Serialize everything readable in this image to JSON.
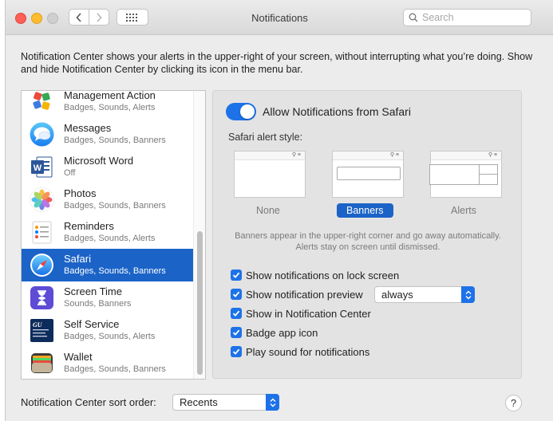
{
  "window": {
    "title": "Notifications",
    "search_placeholder": "Search"
  },
  "description": "Notification Center shows your alerts in the upper-right of your screen, without interrupting what you’re doing. Show and hide Notification Center by clicking its icon in the menu bar.",
  "apps": [
    {
      "name": "Management Action",
      "sub": "Badges, Sounds, Alerts",
      "icon": "management-action-icon",
      "selected": false
    },
    {
      "name": "Messages",
      "sub": "Badges, Sounds, Banners",
      "icon": "messages-icon",
      "selected": false
    },
    {
      "name": "Microsoft Word",
      "sub": "Off",
      "icon": "microsoft-word-icon",
      "selected": false
    },
    {
      "name": "Photos",
      "sub": "Badges, Sounds, Banners",
      "icon": "photos-icon",
      "selected": false
    },
    {
      "name": "Reminders",
      "sub": "Badges, Sounds, Alerts",
      "icon": "reminders-icon",
      "selected": false
    },
    {
      "name": "Safari",
      "sub": "Badges, Sounds, Banners",
      "icon": "safari-icon",
      "selected": true
    },
    {
      "name": "Screen Time",
      "sub": "Sounds, Banners",
      "icon": "screen-time-icon",
      "selected": false
    },
    {
      "name": "Self Service",
      "sub": "Badges, Sounds, Alerts",
      "icon": "self-service-icon",
      "selected": false
    },
    {
      "name": "Wallet",
      "sub": "Badges, Sounds, Banners",
      "icon": "wallet-icon",
      "selected": false
    }
  ],
  "self_service_logo_text": "GU University Information Services",
  "panel": {
    "allow_label": "Allow Notifications from Safari",
    "allow_enabled": true,
    "style_label": "Safari alert style:",
    "styles": {
      "none": "None",
      "banners": "Banners",
      "alerts": "Alerts",
      "selected": "Banners"
    },
    "style_help": "Banners appear in the upper-right corner and go away automatically. Alerts stay on screen until dismissed.",
    "options": {
      "lock_screen": "Show notifications on lock screen",
      "preview": "Show notification preview",
      "notification_center": "Show in Notification Center",
      "badge": "Badge app icon",
      "sound": "Play sound for notifications"
    },
    "preview_value": "always"
  },
  "footer": {
    "sort_label": "Notification Center sort order:",
    "sort_value": "Recents",
    "help": "?"
  },
  "colors": {
    "accent": "#1d72e8",
    "selection": "#1b63c7"
  }
}
